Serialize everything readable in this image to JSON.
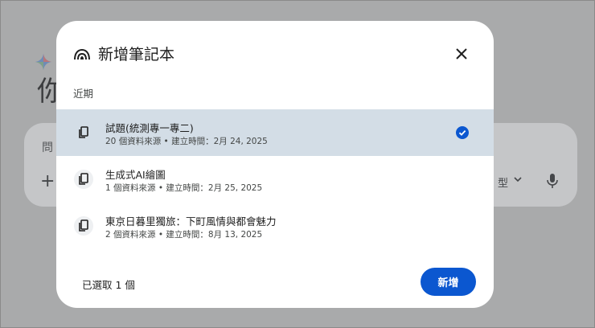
{
  "background": {
    "greeting": "你",
    "input_placeholder": "問",
    "plus": "+",
    "model_fragment": "型",
    "spark_colors": [
      "#4285f4",
      "#ea4335",
      "#fbbc04",
      "#34a853"
    ]
  },
  "dialog": {
    "title": "新增筆記本",
    "close_icon": "close-icon",
    "section_label": "近期",
    "notebooks": [
      {
        "title": "試題(統測專一專二)",
        "meta": "20 個資料來源 • 建立時間：2月 24, 2025",
        "selected": true
      },
      {
        "title": "生成式AI繪圖",
        "meta": "1 個資料來源 • 建立時間：2月 25, 2025",
        "selected": false
      },
      {
        "title": "東京日暮里獨旅：下町風情與都會魅力",
        "meta": "2 個資料來源 • 建立時間：8月 13, 2025",
        "selected": false
      }
    ],
    "selected_count": "已選取 1 個",
    "add_label": "新增"
  },
  "colors": {
    "accent": "#0b57d0",
    "selected_row": "#d3dde6",
    "scrim": "#a9aaab"
  }
}
